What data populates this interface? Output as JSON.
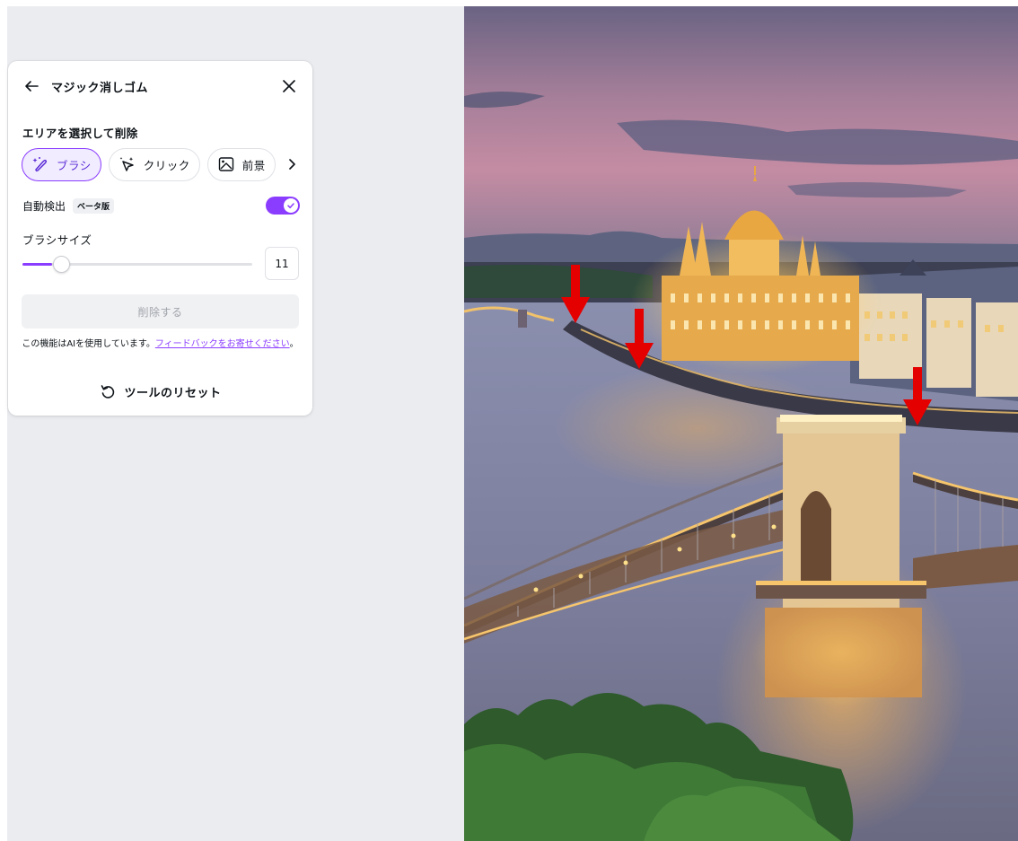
{
  "panel": {
    "title": "マジック消しゴム",
    "section_label": "エリアを選択して削除",
    "modes": [
      {
        "label": "ブラシ",
        "icon": "magic-brush-icon",
        "active": true
      },
      {
        "label": "クリック",
        "icon": "magic-click-icon",
        "active": false
      },
      {
        "label": "前景",
        "icon": "image-foreground-icon",
        "active": false
      }
    ],
    "auto_detect": {
      "label": "自動検出",
      "badge": "ベータ版",
      "enabled": true
    },
    "brush_size": {
      "label": "ブラシサイズ",
      "value": "11",
      "level": 0.13
    },
    "delete_label": "削除する",
    "ai_note": "この機能はAIを使用しています。",
    "ai_link": "フィードバックをお寄せください",
    "ai_note_end": "。",
    "reset_label": "ツールのリセット"
  },
  "colors": {
    "accent": "#8b3dff",
    "canvas_bg": "#ebecf0",
    "arrow_red": "#e50000"
  },
  "photo": {
    "subject": "budapest-parliament-chain-bridge-dusk",
    "annotations": [
      "red-arrow",
      "red-arrow",
      "red-arrow"
    ]
  }
}
